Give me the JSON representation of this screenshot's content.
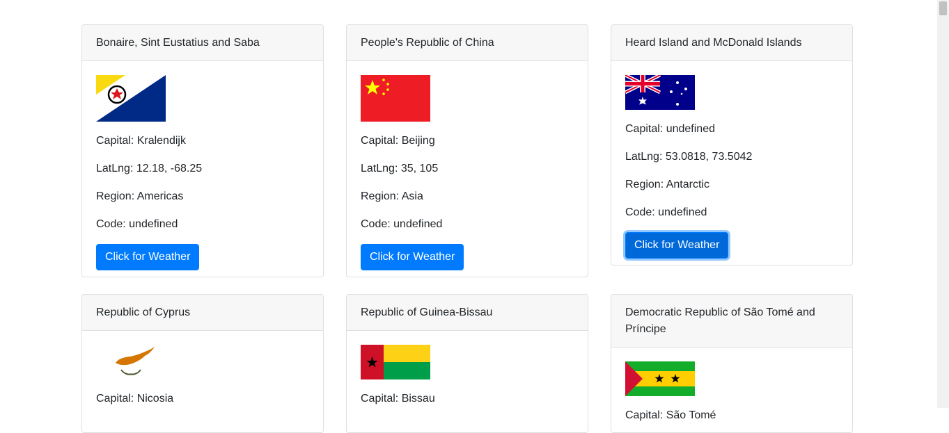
{
  "cards": [
    {
      "name": "Bonaire, Sint Eustatius and Saba",
      "capital": "Capital: Kralendijk",
      "latlng": "LatLng: 12.18, -68.25",
      "region": "Region: Americas",
      "code": "Code: undefined",
      "flag_icon": "bonaire-flag",
      "button": "Click for Weather"
    },
    {
      "name": "People's Republic of China",
      "capital": "Capital: Beijing",
      "latlng": "LatLng: 35, 105",
      "region": "Region: Asia",
      "code": "Code: undefined",
      "flag_icon": "china-flag",
      "button": "Click for Weather"
    },
    {
      "name": "Heard Island and McDonald Islands",
      "capital": "Capital: undefined",
      "latlng": "LatLng: 53.0818, 73.5042",
      "region": "Region: Antarctic",
      "code": "Code: undefined",
      "flag_icon": "australia-flag",
      "button": "Click for Weather"
    },
    {
      "name": "Republic of Cyprus",
      "capital": "Capital: Nicosia",
      "flag_icon": "cyprus-flag"
    },
    {
      "name": "Republic of Guinea-Bissau",
      "capital": "Capital: Bissau",
      "flag_icon": "guinea-bissau-flag"
    },
    {
      "name": "Democratic Republic of São Tomé and Príncipe",
      "capital": "Capital: São Tomé",
      "flag_icon": "sao-tome-flag"
    }
  ],
  "colors": {
    "primary": "#007bff",
    "header_bg": "#f7f7f7",
    "border": "#dfdfdf"
  }
}
